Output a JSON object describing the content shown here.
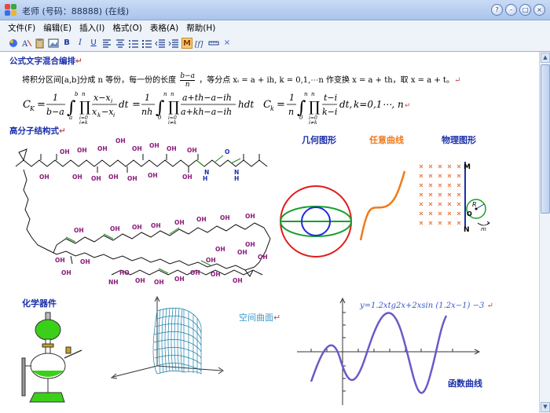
{
  "window": {
    "title": "老师 (号码：88888) (在线)",
    "buttons": [
      "?",
      "–",
      "□",
      "×"
    ]
  },
  "menu": [
    "文件(F)",
    "编辑(E)",
    "插入(I)",
    "格式(O)",
    "表格(A)",
    "帮助(H)"
  ],
  "toolbar": {
    "b_label": "B",
    "i_label": "I",
    "u_label": "U",
    "m_label": "M",
    "close_label": "×"
  },
  "doc": {
    "sec1_title": "公式文字混合编排",
    "para1_start": "将积分区间[a,b]分成 n 等份，每一份的长度",
    "para1_frac_num": "b−a",
    "para1_frac_den": "n",
    "para1_end": "，等分点 xᵢ = a + ih, k = 0,1,⋯n 作变换 x = a + th，取 x = a + t。",
    "formula_left": "C_K = 1/(b−a) ∫ ∏ (x−xᵢ)/(xₖ−xᵢ) dt = 1/(nh) ∫ ∏ (a+th−a−ih)/(a+kh−a−ih) hdt",
    "formula_right": "Cₖ = 1/n ∫ ∏ (t−i)/(k−i) dt,  k=0,1⋯, n",
    "sec2_title": "高分子结构式",
    "fig_geometry": "几何图形",
    "fig_curve": "任意曲线",
    "fig_physics": "物理图形",
    "fig_chem": "化学器件",
    "fig_surface": "空间曲面",
    "fig_function": "函数曲线",
    "function_formula": "y=1.2xtg2x+2xsin (1.2x−1) −3",
    "phys_M": "M",
    "phys_N": "N",
    "phys_R": "R",
    "phys_O": "O",
    "phys_m": "m"
  }
}
